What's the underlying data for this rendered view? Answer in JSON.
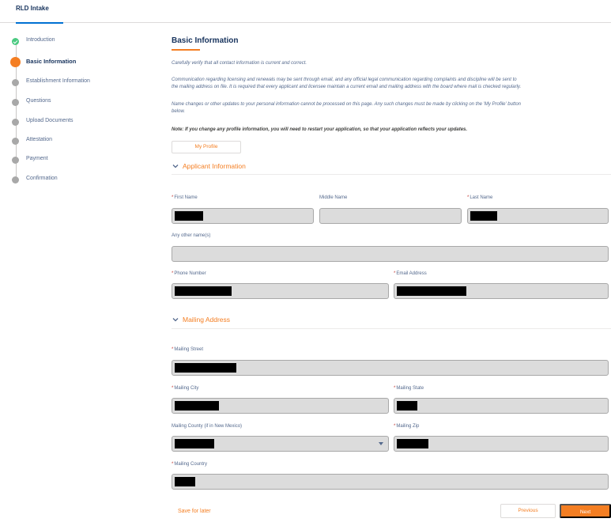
{
  "tab": {
    "label": "RLD Intake"
  },
  "steps": [
    {
      "label": "Introduction",
      "status": "complete"
    },
    {
      "label": "Basic Information",
      "status": "current"
    },
    {
      "label": "Establishment Information",
      "status": "pending"
    },
    {
      "label": "Questions",
      "status": "pending"
    },
    {
      "label": "Upload Documents",
      "status": "pending"
    },
    {
      "label": "Attestation",
      "status": "pending"
    },
    {
      "label": "Payment",
      "status": "pending"
    },
    {
      "label": "Confirmation",
      "status": "pending"
    }
  ],
  "main": {
    "title": "Basic Information",
    "intro": "Carefully verify that all contact information is current and correct.",
    "comm_line1": "Communication regarding licensing and renewals may be sent through email, and any official legal communication regarding complaints and discipline will be sent to",
    "comm_line2": "the mailing address on file. It is required that every applicant and licensee maintain a current email and mailing address with the board where mail is checked regularly.",
    "name_line1": "Name changes or other updates to your personal information cannot be processed on this page. Any such changes must be made by clicking on the 'My Profile' button",
    "name_line2": "below.",
    "note": "Note: If you change any profile information, you will need to restart your application, so that your application reflects your updates.",
    "profile_button": "My Profile"
  },
  "applicant": {
    "header": "Applicant Information",
    "first_name_label": "First Name",
    "middle_name_label": "Middle Name",
    "last_name_label": "Last Name",
    "other_names_label": "Any other name(s)",
    "phone_label": "Phone Number",
    "email_label": "Email Address"
  },
  "mailing": {
    "header": "Mailing Address",
    "street_label": "Mailing Street",
    "city_label": "Mailing City",
    "state_label": "Mailing State",
    "county_label": "Mailing County (if in New Mexico)",
    "zip_label": "Mailing Zip",
    "country_label": "Mailing Country"
  },
  "footer": {
    "save_later": "Save for later",
    "previous": "Previous",
    "next": "Next"
  },
  "required_marker": "*",
  "icons": {
    "complete": "check-icon",
    "section_toggle": "chevron-down-icon",
    "select": "caret-down-icon"
  },
  "colors": {
    "accent": "#f47e22",
    "complete": "#4bca81",
    "pending": "#a8a8a8",
    "field_bg": "#dcdcdc",
    "tab_underline": "#0070d2"
  }
}
